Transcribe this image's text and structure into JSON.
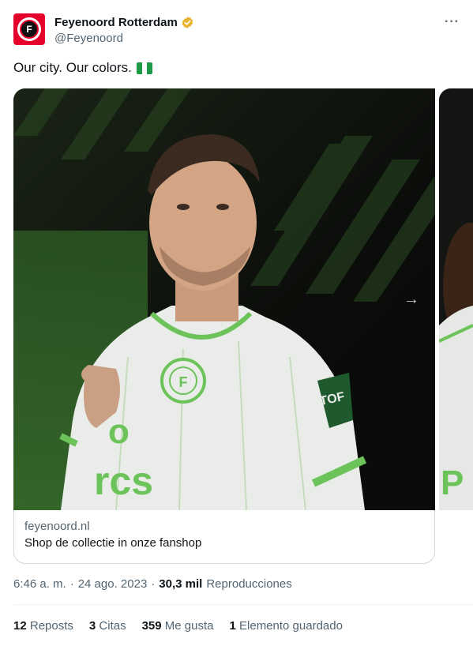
{
  "author": {
    "display_name": "Feyenoord Rotterdam",
    "handle": "@Feyenoord",
    "avatar_icon": "feyenoord-crest-icon",
    "verified_icon": "gold-verified-badge-icon",
    "avatar_color": "#e4002b"
  },
  "tweet": {
    "text": "Our city. Our colors.",
    "emoji_icon": "flag-green-white-green-icon"
  },
  "media": {
    "next_icon": "arrow-right-icon",
    "sponsor_word_1": "o",
    "sponsor_word_2": "rcs",
    "sleeve_text": "TOF",
    "next_shirt_letter": "P"
  },
  "card": {
    "domain": "feyenoord.nl",
    "title": "Shop de collectie in onze fanshop"
  },
  "meta": {
    "time": "6:46 a. m.",
    "separator": "·",
    "date": "24 ago. 2023",
    "views_count": "30,3 mil",
    "views_label": "Reproducciones"
  },
  "stats": {
    "reposts_count": "12",
    "reposts_label": "Reposts",
    "quotes_count": "3",
    "quotes_label": "Citas",
    "likes_count": "359",
    "likes_label": "Me gusta",
    "bookmarks_count": "1",
    "bookmarks_label": "Elemento guardado"
  },
  "colors": {
    "text_primary": "#0f1419",
    "text_secondary": "#536471",
    "border": "#cfd9de",
    "kit_accent": "#6cc35a"
  }
}
